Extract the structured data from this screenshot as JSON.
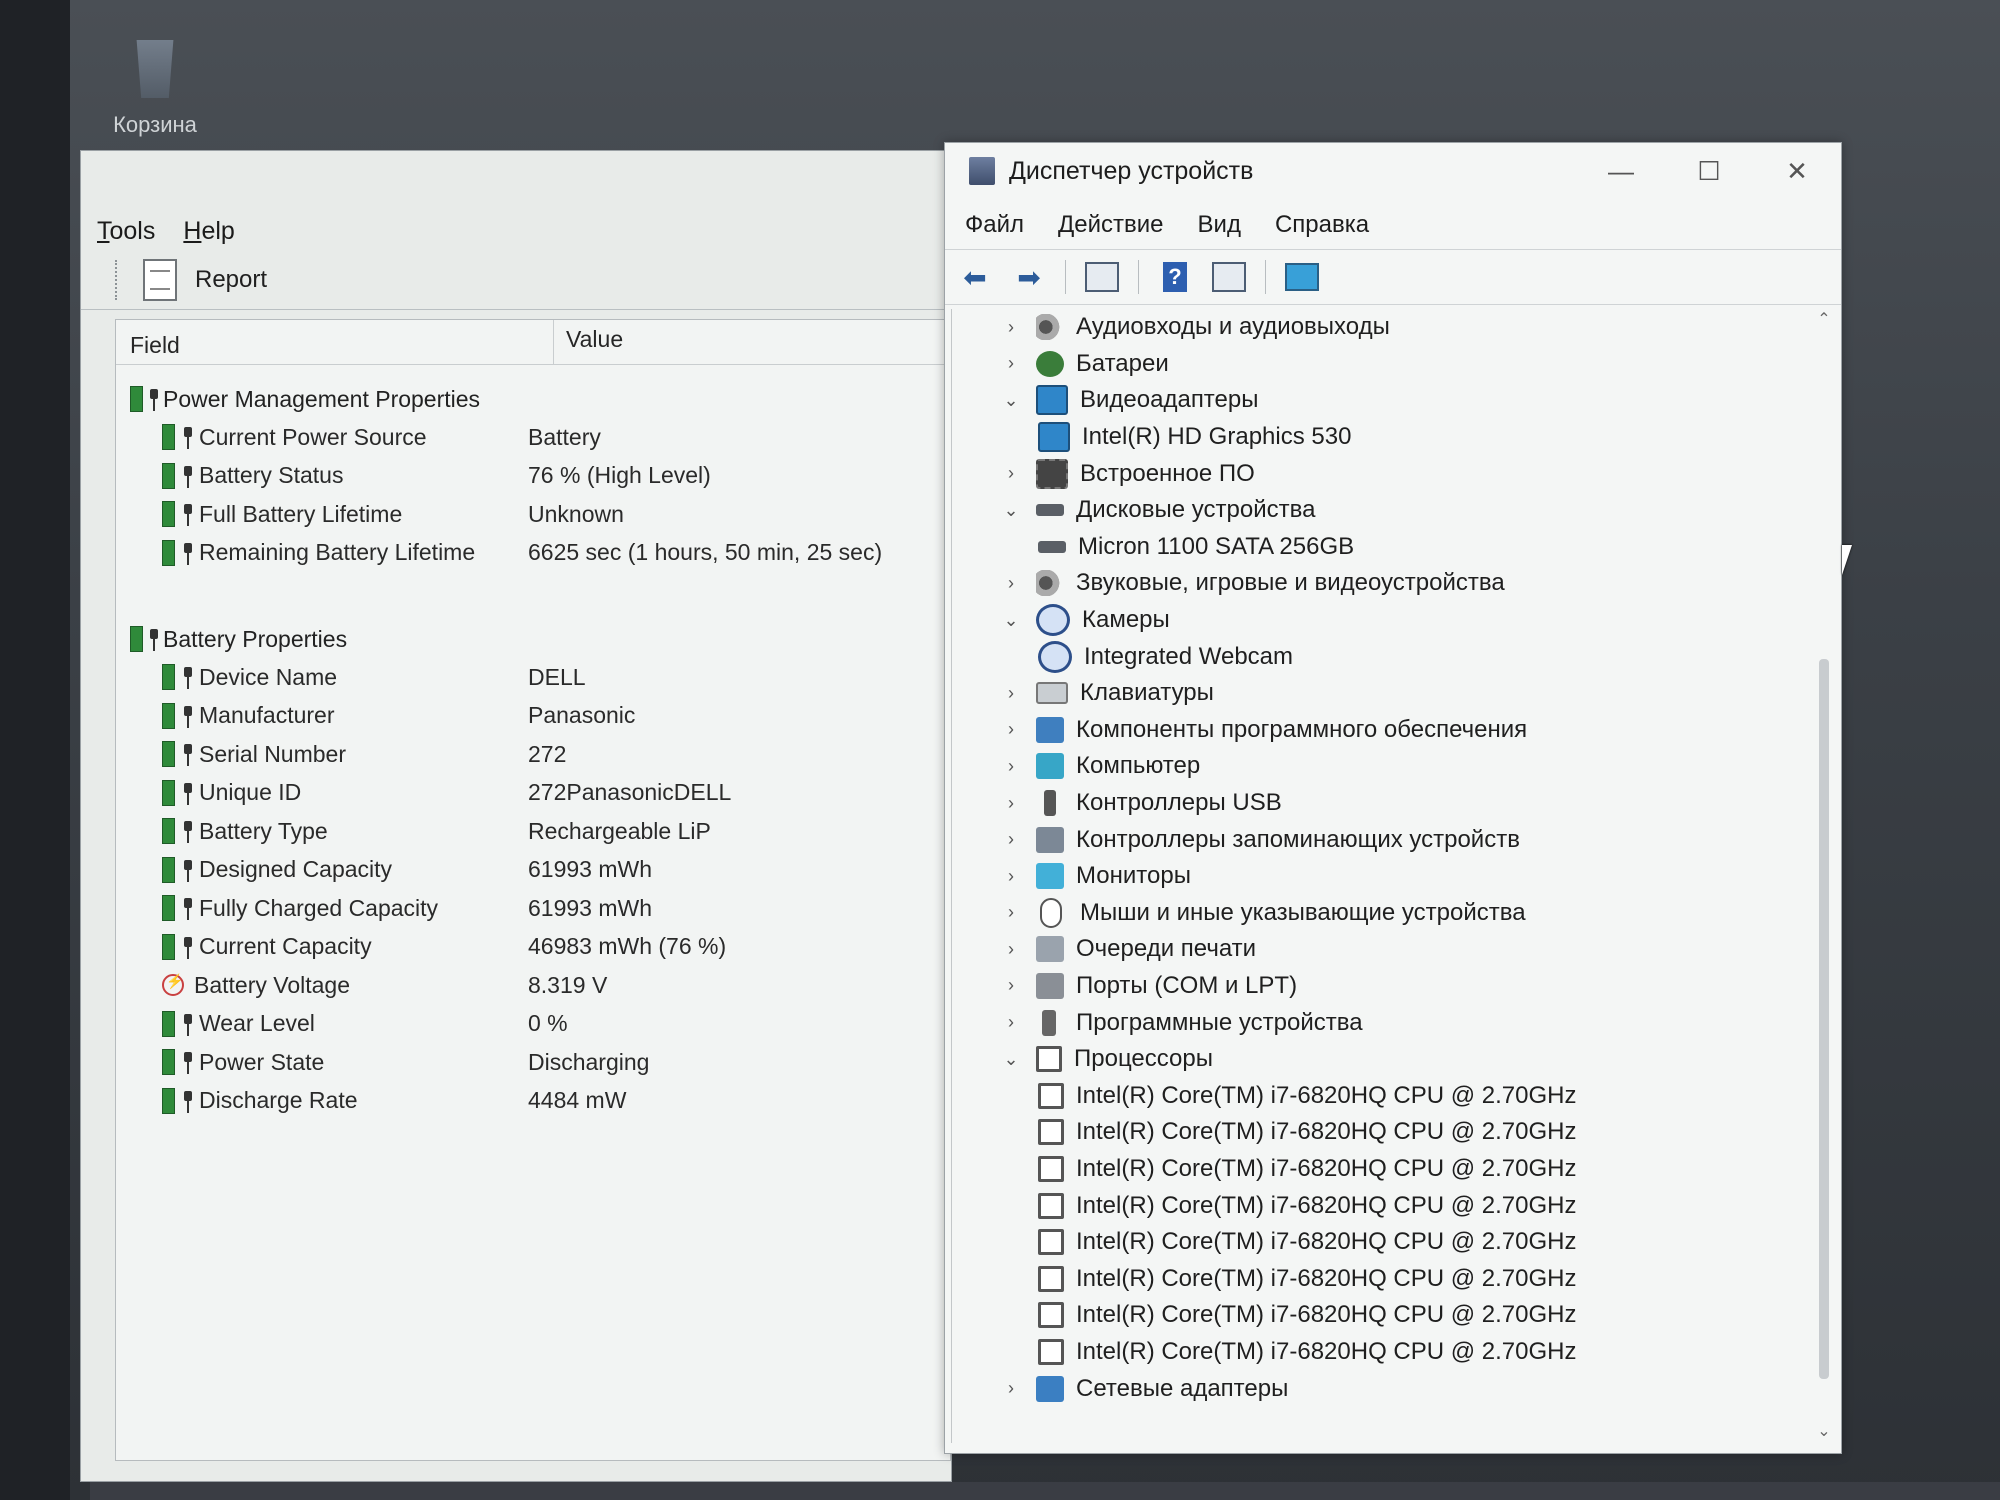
{
  "desktop": {
    "recycle_bin_label": "Корзина"
  },
  "battery_window": {
    "menu": [
      "Tools",
      "Help"
    ],
    "toolbar": {
      "report_label": "Report"
    },
    "columns": {
      "field": "Field",
      "value": "Value"
    },
    "groups": [
      {
        "title": "Power Management Properties",
        "rows": [
          {
            "field": "Current Power Source",
            "value": "Battery"
          },
          {
            "field": "Battery Status",
            "value": "76 % (High Level)"
          },
          {
            "field": "Full Battery Lifetime",
            "value": "Unknown"
          },
          {
            "field": "Remaining Battery Lifetime",
            "value": "6625 sec (1 hours, 50 min, 25 sec)"
          }
        ]
      },
      {
        "title": "Battery Properties",
        "rows": [
          {
            "field": "Device Name",
            "value": "DELL"
          },
          {
            "field": "Manufacturer",
            "value": "Panasonic"
          },
          {
            "field": "Serial Number",
            "value": "272"
          },
          {
            "field": "Unique ID",
            "value": "272PanasonicDELL"
          },
          {
            "field": "Battery Type",
            "value": "Rechargeable LiP"
          },
          {
            "field": "Designed Capacity",
            "value": "61993 mWh"
          },
          {
            "field": "Fully Charged Capacity",
            "value": "61993 mWh"
          },
          {
            "field": "Current Capacity",
            "value": "46983 mWh  (76 %)"
          },
          {
            "field": "Battery Voltage",
            "value": "8.319 V"
          },
          {
            "field": "Wear Level",
            "value": "0 %"
          },
          {
            "field": "Power State",
            "value": "Discharging"
          },
          {
            "field": "Discharge Rate",
            "value": "4484 mW"
          }
        ]
      }
    ]
  },
  "device_manager": {
    "title": "Диспетчер устройств",
    "window_buttons": {
      "minimize": "—",
      "maximize": "☐",
      "close": "✕"
    },
    "menu": [
      "Файл",
      "Действие",
      "Вид",
      "Справка"
    ],
    "toolbar_icons": [
      "back-arrow-icon",
      "forward-arrow-icon",
      "properties-icon",
      "help-icon",
      "view-icon",
      "monitor-icon"
    ],
    "tree": [
      {
        "label": "Аудиовходы и аудиовыходы",
        "icon": "audio",
        "state": "collapsed"
      },
      {
        "label": "Батареи",
        "icon": "battery",
        "state": "collapsed"
      },
      {
        "label": "Видеоадаптеры",
        "icon": "display",
        "state": "expanded"
      },
      {
        "label": "Intel(R) HD Graphics 530",
        "icon": "display",
        "child": true
      },
      {
        "label": "Встроенное ПО",
        "icon": "chip",
        "state": "collapsed"
      },
      {
        "label": "Дисковые устройства",
        "icon": "disk",
        "state": "expanded"
      },
      {
        "label": "Micron 1100 SATA 256GB",
        "icon": "disk",
        "child": true
      },
      {
        "label": "Звуковые, игровые и видеоустройства",
        "icon": "audio",
        "state": "collapsed"
      },
      {
        "label": "Камеры",
        "icon": "camera",
        "state": "expanded"
      },
      {
        "label": "Integrated Webcam",
        "icon": "camera",
        "child": true
      },
      {
        "label": "Клавиатуры",
        "icon": "keyboard",
        "state": "collapsed"
      },
      {
        "label": "Компоненты программного обеспечения",
        "icon": "puzzle",
        "state": "collapsed"
      },
      {
        "label": "Компьютер",
        "icon": "computer",
        "state": "collapsed"
      },
      {
        "label": "Контроллеры USB",
        "icon": "usb",
        "state": "collapsed"
      },
      {
        "label": "Контроллеры запоминающих устройств",
        "icon": "storage",
        "state": "collapsed"
      },
      {
        "label": "Мониторы",
        "icon": "monitor",
        "state": "collapsed"
      },
      {
        "label": "Мыши и иные указывающие устройства",
        "icon": "mouse",
        "state": "collapsed"
      },
      {
        "label": "Очереди печати",
        "icon": "printer",
        "state": "collapsed"
      },
      {
        "label": "Порты (COM и LPT)",
        "icon": "port",
        "state": "collapsed"
      },
      {
        "label": "Программные устройства",
        "icon": "device",
        "state": "collapsed"
      },
      {
        "label": "Процессоры",
        "icon": "cpu",
        "state": "expanded"
      },
      {
        "label": "Intel(R) Core(TM) i7-6820HQ CPU @ 2.70GHz",
        "icon": "cpu",
        "child": true
      },
      {
        "label": "Intel(R) Core(TM) i7-6820HQ CPU @ 2.70GHz",
        "icon": "cpu",
        "child": true
      },
      {
        "label": "Intel(R) Core(TM) i7-6820HQ CPU @ 2.70GHz",
        "icon": "cpu",
        "child": true
      },
      {
        "label": "Intel(R) Core(TM) i7-6820HQ CPU @ 2.70GHz",
        "icon": "cpu",
        "child": true
      },
      {
        "label": "Intel(R) Core(TM) i7-6820HQ CPU @ 2.70GHz",
        "icon": "cpu",
        "child": true
      },
      {
        "label": "Intel(R) Core(TM) i7-6820HQ CPU @ 2.70GHz",
        "icon": "cpu",
        "child": true
      },
      {
        "label": "Intel(R) Core(TM) i7-6820HQ CPU @ 2.70GHz",
        "icon": "cpu",
        "child": true
      },
      {
        "label": "Intel(R) Core(TM) i7-6820HQ CPU @ 2.70GHz",
        "icon": "cpu",
        "child": true
      },
      {
        "label": "Сетевые адаптеры",
        "icon": "net",
        "state": "collapsed"
      }
    ]
  }
}
